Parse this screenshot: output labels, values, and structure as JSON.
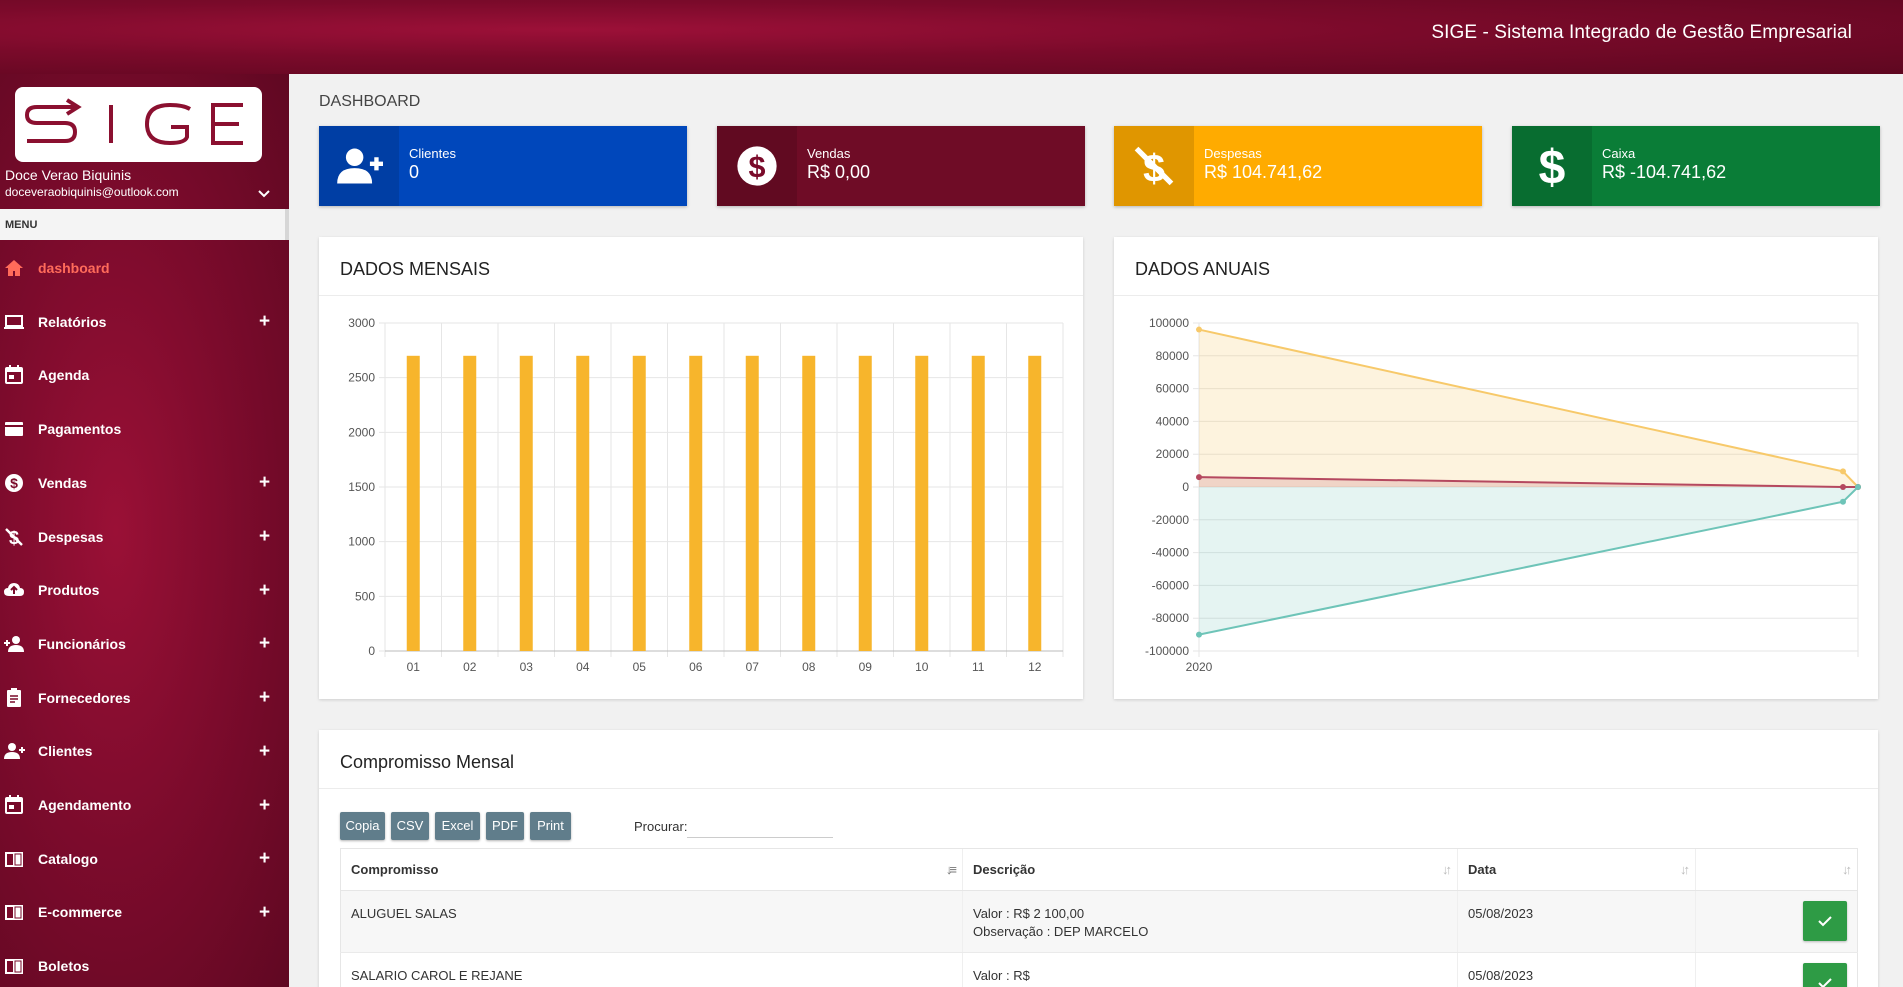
{
  "app": {
    "title": "SIGE - Sistema Integrado de Gestão Empresarial",
    "logo_text": "SIGE"
  },
  "user": {
    "name": "Doce Verao Biquinis",
    "email": "doceveraobiquinis@outlook.com"
  },
  "menu": {
    "header": "MENU",
    "items": [
      {
        "label": "dashboard",
        "icon": "home-icon",
        "has_plus": false,
        "active": true
      },
      {
        "label": "Relatórios",
        "icon": "laptop-icon",
        "has_plus": true
      },
      {
        "label": "Agenda",
        "icon": "calendar-icon",
        "has_plus": false
      },
      {
        "label": "Pagamentos",
        "icon": "card-icon",
        "has_plus": false
      },
      {
        "label": "Vendas",
        "icon": "dollar-circle-icon",
        "has_plus": true
      },
      {
        "label": "Despesas",
        "icon": "money-off-icon",
        "has_plus": true
      },
      {
        "label": "Produtos",
        "icon": "cloud-upload-icon",
        "has_plus": true
      },
      {
        "label": "Funcionários",
        "icon": "person-add-icon",
        "has_plus": true
      },
      {
        "label": "Fornecedores",
        "icon": "clipboard-icon",
        "has_plus": true
      },
      {
        "label": "Clientes",
        "icon": "group-add-icon",
        "has_plus": true
      },
      {
        "label": "Agendamento",
        "icon": "calendar-icon",
        "has_plus": true
      },
      {
        "label": "Catalogo",
        "icon": "book-icon",
        "has_plus": true
      },
      {
        "label": "E-commerce",
        "icon": "book-icon",
        "has_plus": true
      },
      {
        "label": "Boletos",
        "icon": "book-icon",
        "has_plus": false
      }
    ],
    "plus_symbol": "+"
  },
  "dashboard": {
    "title": "DASHBOARD",
    "kpis": [
      {
        "label": "Clientes",
        "value": "0",
        "color": "#0047bb",
        "icon": "group-add-icon"
      },
      {
        "label": "Vendas",
        "value": "R$ 0,00",
        "color": "#6f0c26",
        "icon": "dollar-circle-icon"
      },
      {
        "label": "Despesas",
        "value": "R$ 104.741,62",
        "color": "#ffab00",
        "icon": "money-off-icon"
      },
      {
        "label": "Caixa",
        "value": "R$ -104.741,62",
        "color": "#0a7d37",
        "icon": "dollar-icon"
      }
    ]
  },
  "monthly_card": {
    "title": "DADOS MENSAIS"
  },
  "annual_card": {
    "title": "DADOS ANUAIS"
  },
  "chart_data": [
    {
      "type": "bar",
      "title": "DADOS MENSAIS",
      "categories": [
        "01",
        "02",
        "03",
        "04",
        "05",
        "06",
        "07",
        "08",
        "09",
        "10",
        "11",
        "12"
      ],
      "values": [
        2700,
        2700,
        2700,
        2700,
        2700,
        2700,
        2700,
        2700,
        2700,
        2700,
        2700,
        2700
      ],
      "ylim": [
        0,
        3000
      ],
      "yticks": [
        0,
        500,
        1000,
        1500,
        2000,
        2500,
        3000
      ],
      "grid": true,
      "color": "#f7b52c"
    },
    {
      "type": "area",
      "title": "DADOS ANUAIS",
      "x": [
        "2020",
        "",
        ""
      ],
      "ylim": [
        -100000,
        100000
      ],
      "yticks": [
        -100000,
        -80000,
        -60000,
        -40000,
        -20000,
        0,
        20000,
        40000,
        60000,
        80000,
        100000
      ],
      "grid": true,
      "series": [
        {
          "values": [
            96000,
            9500,
            0
          ],
          "color": "#f7c96a"
        },
        {
          "values": [
            6000,
            0,
            0
          ],
          "color": "#b5485f"
        },
        {
          "values": [
            -90000,
            -9000,
            0
          ],
          "color": "#6ec4b8"
        }
      ]
    }
  ],
  "commitments": {
    "title": "Compromisso Mensal",
    "buttons": [
      "Copia",
      "CSV",
      "Excel",
      "PDF",
      "Print"
    ],
    "search_label": "Procurar:",
    "search_value": "",
    "columns": [
      "Compromisso",
      "Descrição",
      "Data",
      ""
    ],
    "rows": [
      {
        "name": "ALUGUEL SALAS",
        "desc1": "Valor : R$ 2 100,00",
        "desc2": "Observação : DEP MARCELO",
        "date": "05/08/2023"
      },
      {
        "name": "SALARIO CAROL E REJANE",
        "desc1": "Valor : R$",
        "desc2": "",
        "date": "05/08/2023"
      }
    ]
  }
}
